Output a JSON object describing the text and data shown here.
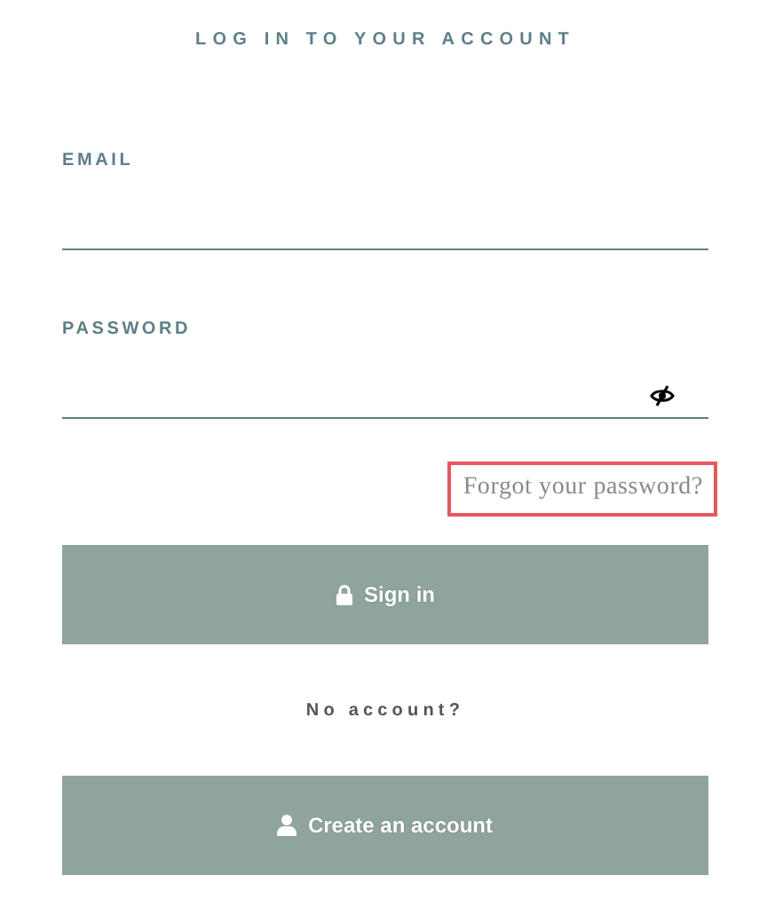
{
  "title": "LOG IN TO YOUR ACCOUNT",
  "fields": [
    {
      "label": "EMAIL",
      "kind": "text"
    },
    {
      "label": "PASSWORD",
      "kind": "password"
    }
  ],
  "forgot_link": {
    "text": "Forgot your password?",
    "highlighted": true
  },
  "sign_in_button": {
    "label": "Sign in"
  },
  "no_account": "No account?",
  "create_button": {
    "label": "Create an account"
  }
}
